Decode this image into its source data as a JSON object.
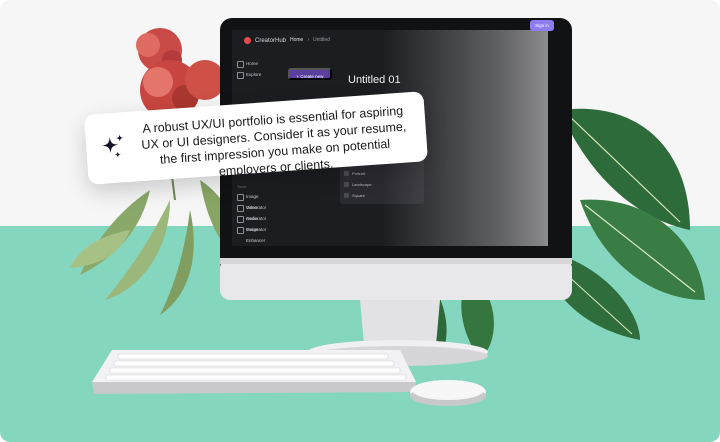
{
  "callout": {
    "text": "A robust UX/UI portfolio is essential for aspiring UX or UI designers. Consider it as your resume, the first impression you make on potential employers or clients.",
    "icon": "sparkles-icon"
  },
  "app": {
    "name": "CreatorHub",
    "breadcrumb": [
      "Home",
      "Untitled"
    ],
    "sign_in_label": "Sign in",
    "create_label": "+ Create new",
    "page_title": "Untitled 01",
    "sidebar": {
      "items": [
        "Home",
        "Explore"
      ],
      "section_label": "Tools",
      "tools": [
        "Image Generator",
        "Video Generator",
        "Audio Generator",
        "Image Enhancer"
      ]
    },
    "options": [
      "Portrait",
      "Landscape",
      "Square"
    ],
    "accent": "#8e7cf0"
  },
  "colors": {
    "backdrop_top": "#f6f6f6",
    "backdrop_bottom": "#85d6be",
    "screen": "#1c1d21"
  }
}
